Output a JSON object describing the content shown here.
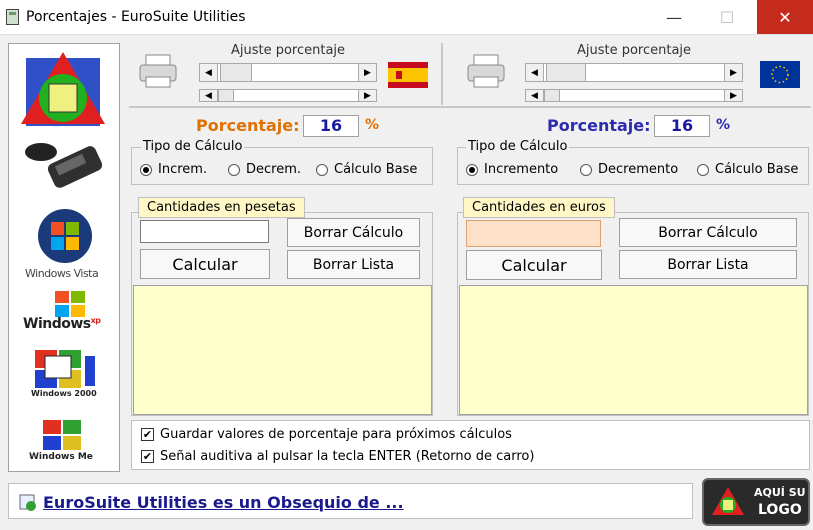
{
  "window": {
    "title": "Porcentajes - EuroSuite Utilities"
  },
  "left_panel": {
    "header": "Ajuste porcentaje",
    "percent_label": "Porcentaje:",
    "percent_value": "16",
    "percent_sign": "%",
    "calc_group_title": "Tipo de Cálculo",
    "radios": [
      {
        "label": "Increm.",
        "checked": true
      },
      {
        "label": "Decrem.",
        "checked": false
      },
      {
        "label": "Cálculo Base",
        "checked": false
      }
    ],
    "tab_label": "Cantidades en pesetas",
    "input_value": "",
    "btn_borrar_calculo": "Borrar Cálculo",
    "btn_calcular": "Calcular",
    "btn_borrar_lista": "Borrar Lista",
    "label_color": "#e07000"
  },
  "right_panel": {
    "header": "Ajuste porcentaje",
    "percent_label": "Porcentaje:",
    "percent_value": "16",
    "percent_sign": "%",
    "calc_group_title": "Tipo de Cálculo",
    "radios": [
      {
        "label": "Incremento",
        "checked": true
      },
      {
        "label": "Decremento",
        "checked": false
      },
      {
        "label": "Cálculo Base",
        "checked": false
      }
    ],
    "tab_label": "Cantidades en euros",
    "input_value": "",
    "btn_borrar_calculo": "Borrar Cálculo",
    "btn_calcular": "Calcular",
    "btn_borrar_lista": "Borrar Lista",
    "label_color": "#2b2bb0"
  },
  "options": [
    {
      "label": "Guardar valores de porcentaje para próximos cálculos",
      "checked": true
    },
    {
      "label": "Señal auditiva al pulsar la tecla ENTER (Retorno de carro)",
      "checked": true
    }
  ],
  "logos": {
    "vista": "Windows Vista",
    "xp": "Windows",
    "xp_sup": "xp",
    "w2000": "Windows 2000",
    "me": "Windows Me"
  },
  "footer": {
    "link_text": "EuroSuite Utilities es un Obsequio de ...",
    "badge_line1": "AQUÍ SU",
    "badge_line2": "LOGO"
  }
}
